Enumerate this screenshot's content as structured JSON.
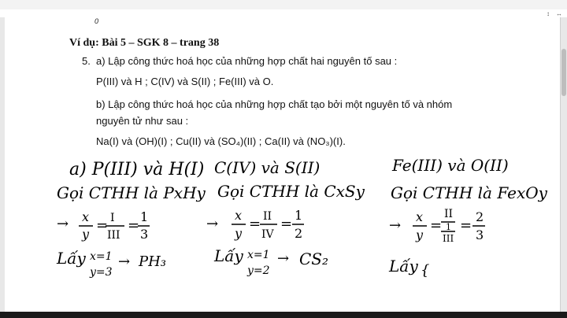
{
  "toolbar": {
    "ruler_glyph": "0",
    "icons": [
      "↕",
      "↔"
    ]
  },
  "document": {
    "heading": "Ví dụ: Bài 5 – SGK 8 – trang 38",
    "question_number": "5.",
    "part_a": "a) Lập công thức hoá học của những hợp chất hai nguyên tố sau :",
    "part_a_data": "P(III) và H ; C(IV) và S(II) ; Fe(III) và O.",
    "part_b_line1": "b) Lập công thức hoá học của những hợp chất tạo bởi một nguyên tố và nhóm",
    "part_b_line2": "nguyên tử như sau :",
    "part_b_data": "Na(I) và (OH)(I) ; Cu(II) và (SO₄)(II) ; Ca(II) và (NO₃)(I)."
  },
  "handwriting": {
    "col1": {
      "title": "a)  P(III) và H(I)",
      "formula_line": "Gọi CTHH là PxHy",
      "ratio": "x/y = I/III = 1/3",
      "take": "Lấy x=1, y=3 → PH₃"
    },
    "col2": {
      "title": "C(IV) và S(II)",
      "formula_line": "Gọi CTHH là CxSy",
      "ratio": "x/y = II/IV = 1/2",
      "take": "Lấy x=1, y=2 → CS₂"
    },
    "col3": {
      "title": "Fe(III) và O(II)",
      "formula_line": "Gọi CTHH là FexOy",
      "ratio": "x/y = II/III = 2/3",
      "take": "Lấy"
    }
  }
}
